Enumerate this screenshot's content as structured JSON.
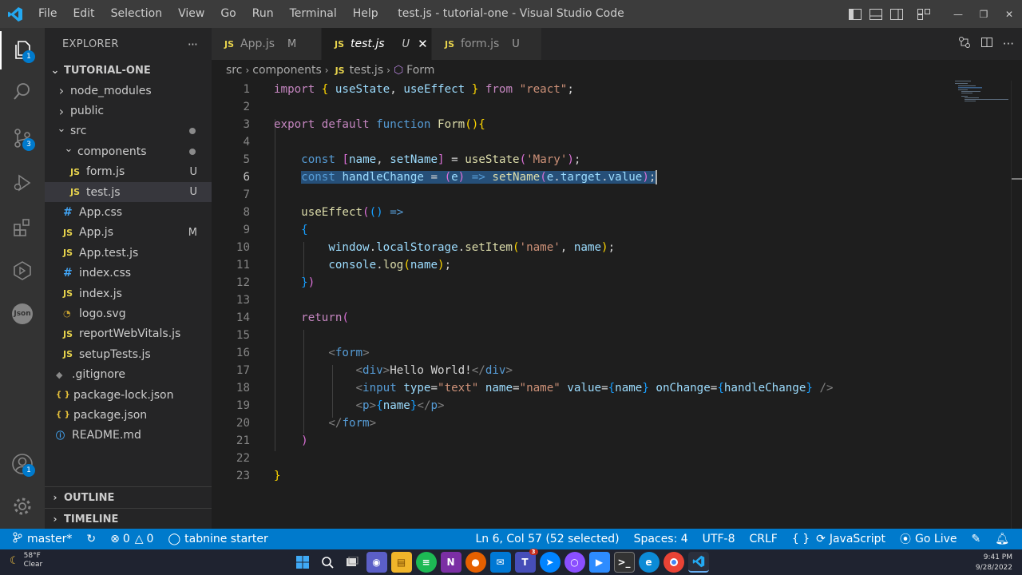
{
  "titlebar": {
    "menu": [
      "File",
      "Edit",
      "Selection",
      "View",
      "Go",
      "Run",
      "Terminal",
      "Help"
    ],
    "window_title": "test.js - tutorial-one - Visual Studio Code"
  },
  "activity": {
    "explorer_badge": "1",
    "scm_badge": "3",
    "accounts_badge": "1",
    "json_label": "Json"
  },
  "sidebar": {
    "header": "EXPLORER",
    "more": "···",
    "project": "TUTORIAL-ONE",
    "items": [
      {
        "label": "node_modules",
        "kind": "folder-closed",
        "depth": 1
      },
      {
        "label": "public",
        "kind": "folder-closed",
        "depth": 1
      },
      {
        "label": "src",
        "kind": "folder-open",
        "depth": 1,
        "dot": true
      },
      {
        "label": "components",
        "kind": "folder-open",
        "depth": 2,
        "dot": true
      },
      {
        "label": "form.js",
        "kind": "js",
        "depth": 3,
        "status": "U"
      },
      {
        "label": "test.js",
        "kind": "js",
        "depth": 3,
        "status": "U",
        "selected": true
      },
      {
        "label": "App.css",
        "kind": "css",
        "depth": 2
      },
      {
        "label": "App.js",
        "kind": "js",
        "depth": 2,
        "status": "M"
      },
      {
        "label": "App.test.js",
        "kind": "js",
        "depth": 2
      },
      {
        "label": "index.css",
        "kind": "css",
        "depth": 2
      },
      {
        "label": "index.js",
        "kind": "js",
        "depth": 2
      },
      {
        "label": "logo.svg",
        "kind": "svg",
        "depth": 2
      },
      {
        "label": "reportWebVitals.js",
        "kind": "js",
        "depth": 2
      },
      {
        "label": "setupTests.js",
        "kind": "js",
        "depth": 2
      },
      {
        "label": ".gitignore",
        "kind": "git",
        "depth": 1
      },
      {
        "label": "package-lock.json",
        "kind": "json",
        "depth": 1
      },
      {
        "label": "package.json",
        "kind": "json",
        "depth": 1
      },
      {
        "label": "README.md",
        "kind": "md",
        "depth": 1
      }
    ],
    "outline": "OUTLINE",
    "timeline": "TIMELINE"
  },
  "tabs": [
    {
      "label": "App.js",
      "mark": "M",
      "active": false
    },
    {
      "label": "test.js",
      "mark": "U",
      "active": true
    },
    {
      "label": "form.js",
      "mark": "U",
      "active": false
    }
  ],
  "breadcrumb": [
    "src",
    "components",
    "test.js",
    "Form"
  ],
  "editor": {
    "current_line": 6
  },
  "statusbar": {
    "branch": "master*",
    "errors": "0",
    "warnings": "0",
    "tabnine": "tabnine starter",
    "position": "Ln 6, Col 57 (52 selected)",
    "spaces": "Spaces: 4",
    "encoding": "UTF-8",
    "eol": "CRLF",
    "braces": "{ }",
    "language": "JavaScript",
    "golive": "Go Live"
  },
  "taskbar": {
    "temp": "58°F",
    "condition": "Clear",
    "time": "9:41 PM",
    "date": "9/28/2022",
    "teams_badge": "3"
  },
  "colors": {
    "accent": "#007acc",
    "titlebar": "#3c3c3c",
    "sidebar": "#252526",
    "editor": "#1e1e1e",
    "selection": "#264f78"
  }
}
